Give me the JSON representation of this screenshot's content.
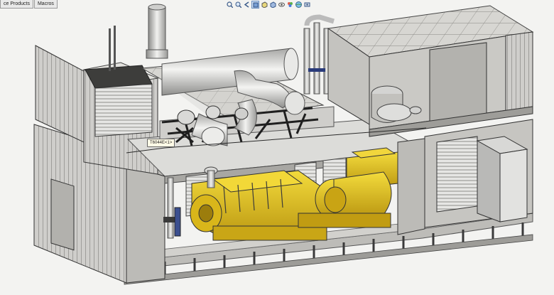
{
  "window": {
    "tabs": [
      "ce Products",
      "Macros"
    ]
  },
  "heads_up_toolbar": {
    "icons": [
      "zoom-to-fit-icon",
      "zoom-area-icon",
      "previous-view-icon",
      "section-view-icon",
      "view-orientation-icon",
      "display-style-icon",
      "hide-show-icon",
      "edit-appearance-icon",
      "scene-icon",
      "view-settings-icon"
    ]
  },
  "model": {
    "component_callout": "T6044E<1>",
    "colors": {
      "background": "#f3f3f1",
      "enclosure_panel": "#c9c8c4",
      "engine_yellow": "#e3c21a",
      "exhaust_silencer": "#dededb"
    }
  }
}
